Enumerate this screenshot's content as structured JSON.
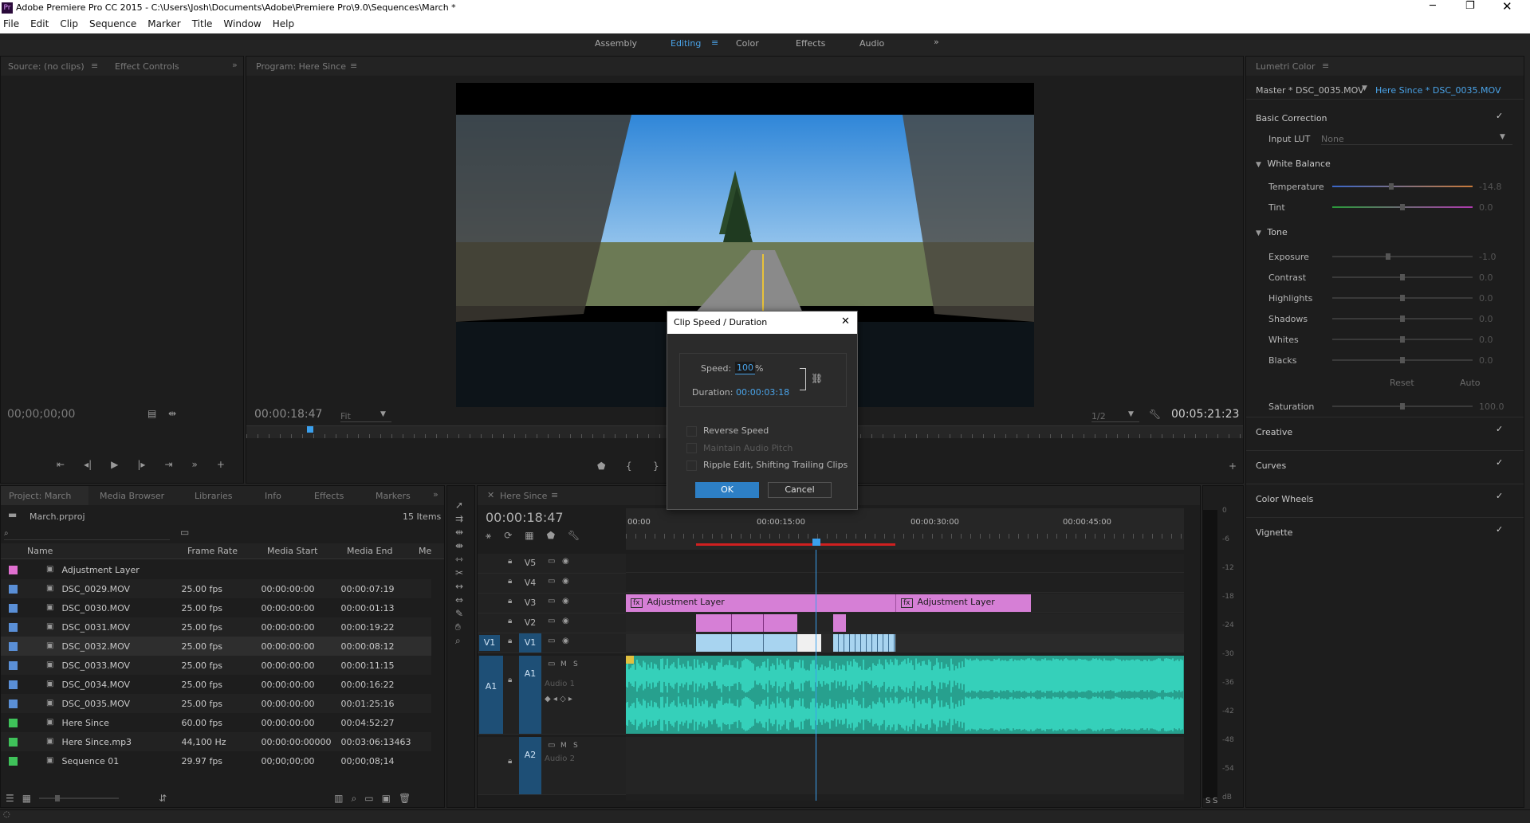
{
  "window": {
    "title": "Adobe Premiere Pro CC 2015 - C:\\Users\\Josh\\Documents\\Adobe\\Premiere Pro\\9.0\\Sequences\\March *"
  },
  "menu": [
    "File",
    "Edit",
    "Clip",
    "Sequence",
    "Marker",
    "Title",
    "Window",
    "Help"
  ],
  "workspaces": {
    "items": [
      "Assembly",
      "Editing",
      "Color",
      "Effects",
      "Audio"
    ],
    "active": "Editing",
    "overflow": "»"
  },
  "source_panel": {
    "tabs": [
      "Source: (no clips)",
      "Effect Controls"
    ],
    "timecode": "00;00;00;00"
  },
  "program_panel": {
    "tab": "Program: Here Since",
    "timecode_left": "00:00:18:47",
    "fit": "Fit",
    "res": "1/2",
    "timecode_right": "00:05:21:23"
  },
  "project_panel": {
    "tabs": [
      "Project: March",
      "Media Browser",
      "Libraries",
      "Info",
      "Effects",
      "Markers"
    ],
    "file": "March.prproj",
    "count": "15 Items",
    "columns": [
      "Name",
      "Frame Rate",
      "Media Start",
      "Media End",
      "Me"
    ],
    "rows": [
      {
        "name": "Adjustment Layer",
        "rate": "",
        "start": "",
        "end": "",
        "color": "#e070d0"
      },
      {
        "name": "DSC_0029.MOV",
        "rate": "25.00 fps",
        "start": "00:00:00:00",
        "end": "00:00:07:19",
        "color": "#5a8fd6"
      },
      {
        "name": "DSC_0030.MOV",
        "rate": "25.00 fps",
        "start": "00:00:00:00",
        "end": "00:00:01:13",
        "color": "#5a8fd6"
      },
      {
        "name": "DSC_0031.MOV",
        "rate": "25.00 fps",
        "start": "00:00:00:00",
        "end": "00:00:19:22",
        "color": "#5a8fd6"
      },
      {
        "name": "DSC_0032.MOV",
        "rate": "25.00 fps",
        "start": "00:00:00:00",
        "end": "00:00:08:12",
        "color": "#5a8fd6"
      },
      {
        "name": "DSC_0033.MOV",
        "rate": "25.00 fps",
        "start": "00:00:00:00",
        "end": "00:00:11:15",
        "color": "#5a8fd6"
      },
      {
        "name": "DSC_0034.MOV",
        "rate": "25.00 fps",
        "start": "00:00:00:00",
        "end": "00:00:16:22",
        "color": "#5a8fd6"
      },
      {
        "name": "DSC_0035.MOV",
        "rate": "25.00 fps",
        "start": "00:00:00:00",
        "end": "00:01:25:16",
        "color": "#5a8fd6"
      },
      {
        "name": "Here Since",
        "rate": "60.00 fps",
        "start": "00:00:00:00",
        "end": "00:04:52:27",
        "color": "#3fc25a"
      },
      {
        "name": "Here Since.mp3",
        "rate": "44,100 Hz",
        "start": "00:00:00:00000",
        "end": "00:03:06:13463",
        "color": "#3fc25a"
      },
      {
        "name": "Sequence 01",
        "rate": "29.97 fps",
        "start": "00;00;00;00",
        "end": "00;00;08;14",
        "color": "#3fc25a"
      }
    ]
  },
  "timeline": {
    "tab": "Here Since",
    "timecode": "00:00:18:47",
    "ruler": [
      "00:00",
      "00:00:15:00",
      "00:00:30:00",
      "00:00:45:00"
    ],
    "tracks": [
      "V5",
      "V4",
      "V3",
      "V2",
      "V1",
      "A1",
      "A2"
    ],
    "source_v": "V1",
    "source_a": "A1",
    "audio1_name": "Audio 1",
    "audio2_name": "Audio 2",
    "clip_labels": [
      "Adjustment Layer",
      "Adjustment Layer"
    ],
    "fx": "fx"
  },
  "meter": {
    "ticks": [
      "0",
      "-6",
      "-12",
      "-18",
      "-24",
      "-30",
      "-36",
      "-42",
      "-48",
      "-54",
      "dB"
    ],
    "solo": [
      "S",
      "S"
    ]
  },
  "lumetri": {
    "tab": "Lumetri Color",
    "master": "Master * DSC_0035.MOV",
    "clip": "Here Since * DSC_0035.MOV",
    "basic": "Basic Correction",
    "input_lut_label": "Input LUT",
    "input_lut_value": "None",
    "white_balance": "White Balance",
    "wb_rows": [
      {
        "label": "Temperature",
        "value": "-14.8",
        "pos": 0.42
      },
      {
        "label": "Tint",
        "value": "0.0",
        "pos": 0.5
      }
    ],
    "tone": "Tone",
    "tone_rows": [
      {
        "label": "Exposure",
        "value": "-1.0",
        "pos": 0.4
      },
      {
        "label": "Contrast",
        "value": "0.0",
        "pos": 0.5
      },
      {
        "label": "Highlights",
        "value": "0.0",
        "pos": 0.5
      },
      {
        "label": "Shadows",
        "value": "0.0",
        "pos": 0.5
      },
      {
        "label": "Whites",
        "value": "0.0",
        "pos": 0.5
      },
      {
        "label": "Blacks",
        "value": "0.0",
        "pos": 0.5
      }
    ],
    "reset": "Reset",
    "auto": "Auto",
    "saturation_label": "Saturation",
    "saturation_value": "100.0",
    "sections": [
      "Creative",
      "Curves",
      "Color Wheels",
      "Vignette"
    ]
  },
  "dialog": {
    "title": "Clip Speed / Duration",
    "speed_label": "Speed:",
    "speed_value": "100",
    "speed_unit": "%",
    "duration_label": "Duration:",
    "duration_value": "00:00:03:18",
    "reverse": "Reverse Speed",
    "maintain": "Maintain Audio Pitch",
    "ripple": "Ripple Edit, Shifting Trailing Clips",
    "ok": "OK",
    "cancel": "Cancel"
  }
}
